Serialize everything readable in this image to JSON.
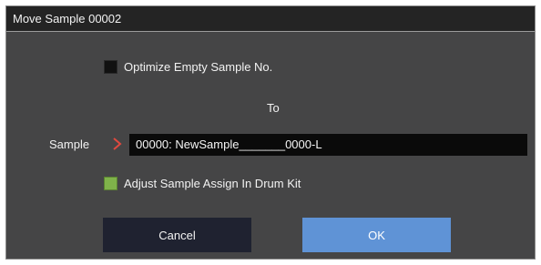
{
  "dialog": {
    "title": "Move Sample 00002"
  },
  "optimize": {
    "label": "Optimize Empty Sample No.",
    "checked": false
  },
  "to_label": "To",
  "sample": {
    "label": "Sample",
    "value": "00000: NewSample_______0000-L",
    "chevron_icon": "chevron-right-icon",
    "chevron_color": "#e0493f"
  },
  "adjust": {
    "label": "Adjust Sample Assign In Drum Kit",
    "checked": true
  },
  "buttons": {
    "cancel_label": "Cancel",
    "ok_label": "OK"
  },
  "colors": {
    "dialog_bg": "#454546",
    "title_bg": "#242424",
    "ok_bg": "#5f93d6",
    "cancel_bg": "#1f2230",
    "checkbox_on": "#7fb24a"
  }
}
